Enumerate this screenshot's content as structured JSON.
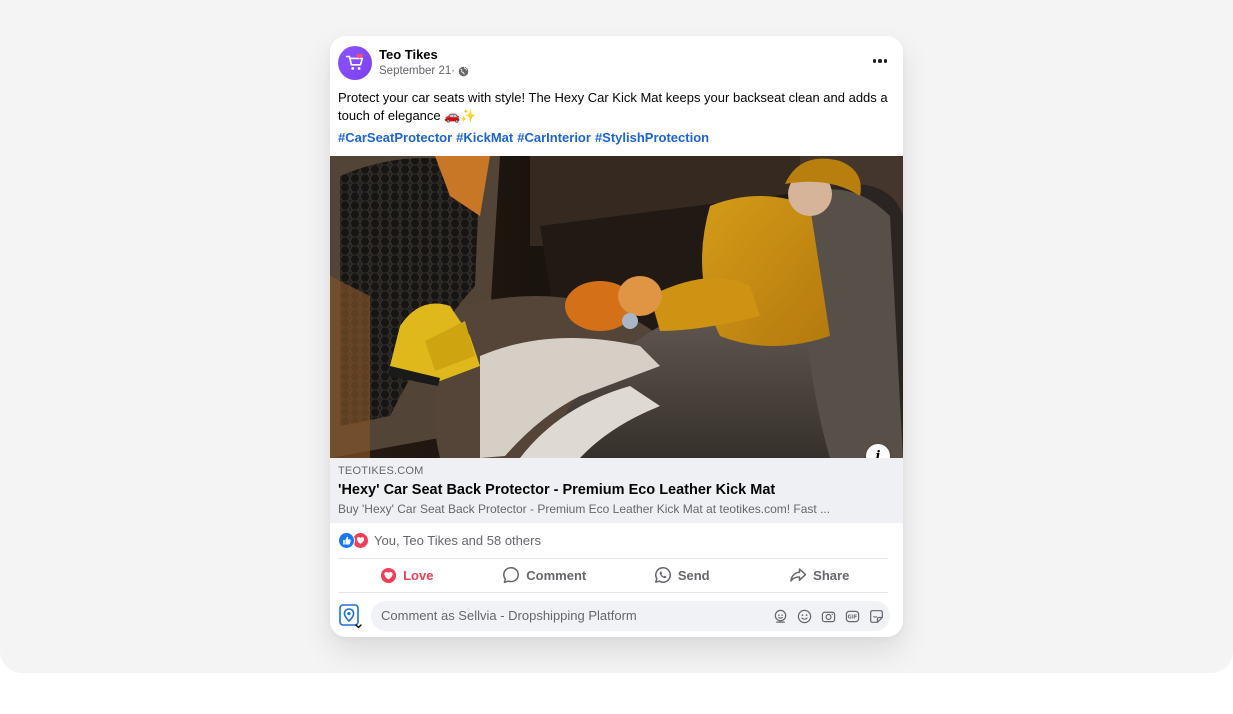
{
  "post": {
    "page_name": "Teo Tikes",
    "date": "September 21·",
    "privacy_icon": "globe-icon",
    "text": "Protect your car seats with style! The Hexy Car Kick Mat keeps your backseat clean and adds a touch of elegance 🚗✨",
    "hashtags": [
      "#CarSeatProtector",
      "#KickMat",
      "#CarInterior",
      "#StylishProtection"
    ]
  },
  "link_preview": {
    "domain": "TEOTIKES.COM",
    "title": "'Hexy' Car Seat Back Protector - Premium Eco Leather Kick Mat",
    "description": "Buy 'Hexy' Car Seat Back Protector - Premium Eco Leather Kick Mat at teotikes.com! Fast ..."
  },
  "reactions": {
    "icons": [
      "like-icon",
      "love-icon"
    ],
    "summary": "You, Teo Tikes and 58 others"
  },
  "actions": {
    "love": "Love",
    "comment": "Comment",
    "send": "Send",
    "share": "Share"
  },
  "comment_box": {
    "placeholder": "Comment as Sellvia - Dropshipping Platform",
    "tools": [
      "avatar-sticker-icon",
      "emoji-icon",
      "camera-icon",
      "gif-icon",
      "sticker-icon"
    ]
  },
  "colors": {
    "hashtag": "#1b64d8",
    "love": "#f33e58",
    "like": "#1877f2",
    "avatar": "#7b3ff2"
  }
}
